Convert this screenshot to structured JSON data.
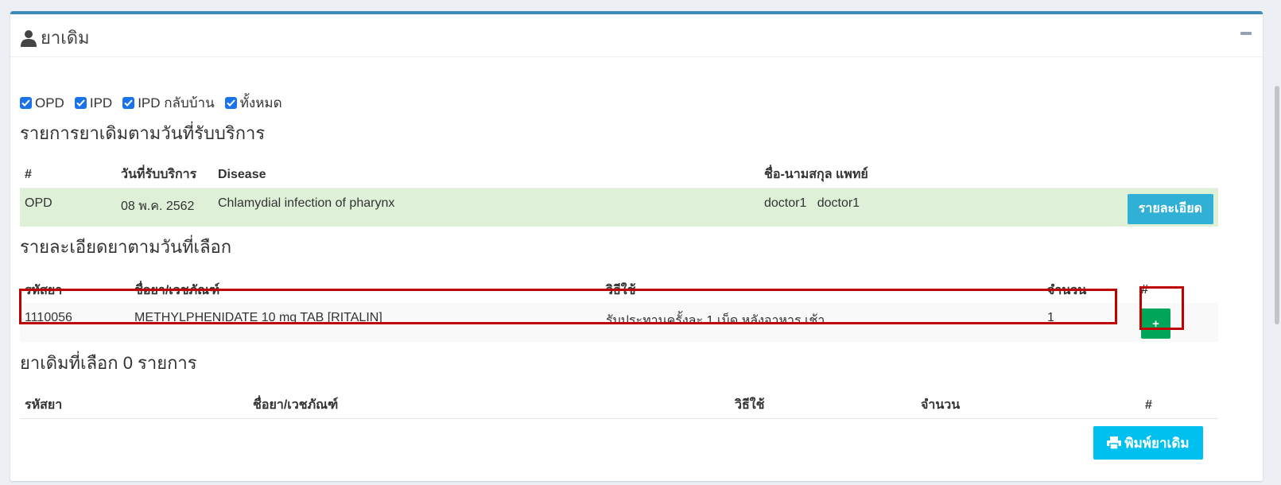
{
  "panel": {
    "title": "ยาเดิม"
  },
  "filters": [
    {
      "label": "OPD",
      "checked": true
    },
    {
      "label": "IPD",
      "checked": true
    },
    {
      "label": "IPD กลับบ้าน",
      "checked": true
    },
    {
      "label": "ทั้งหมด",
      "checked": true
    }
  ],
  "visits": {
    "heading": "รายการยาเดิมตามวันที่รับบริการ",
    "columns": [
      "#",
      "วันที่รับบริการ",
      "Disease",
      "ชื่อ-นามสกุล แพทย์"
    ],
    "rows": [
      {
        "type": "OPD",
        "date": "08 พ.ค. 2562",
        "disease": "Chlamydial infection of pharynx",
        "doctor": "doctor1   doctor1",
        "button": "รายละเอียด"
      }
    ]
  },
  "details": {
    "heading": "รายละเอียดยาตามวันที่เลือก",
    "columns": [
      "รหัสยา",
      "ชื่อยา/เวชภัณฑ์",
      "วิธีใช้",
      "จำนวน",
      "#"
    ],
    "rows": [
      {
        "code": "1110056",
        "name": "METHYLPHENIDATE 10 mg TAB [RITALIN]",
        "usage": "รับประทานครั้งละ 1 เม็ด หลังอาหาร เช้า",
        "qty": "1",
        "button": "+"
      }
    ]
  },
  "selected": {
    "heading": "ยาเดิมที่เลือก 0 รายการ",
    "columns": [
      "รหัสยา",
      "ชื่อยา/เวชภัณฑ์",
      "วิธีใช้",
      "จำนวน",
      "#"
    ]
  },
  "print_button": "พิมพ์ยาเดิม",
  "colors": {
    "accent": "#3c8dbc",
    "success": "#00a65a",
    "info": "#00c0ef",
    "highlight": "#c00000",
    "visit_row": "#dff0d8"
  }
}
